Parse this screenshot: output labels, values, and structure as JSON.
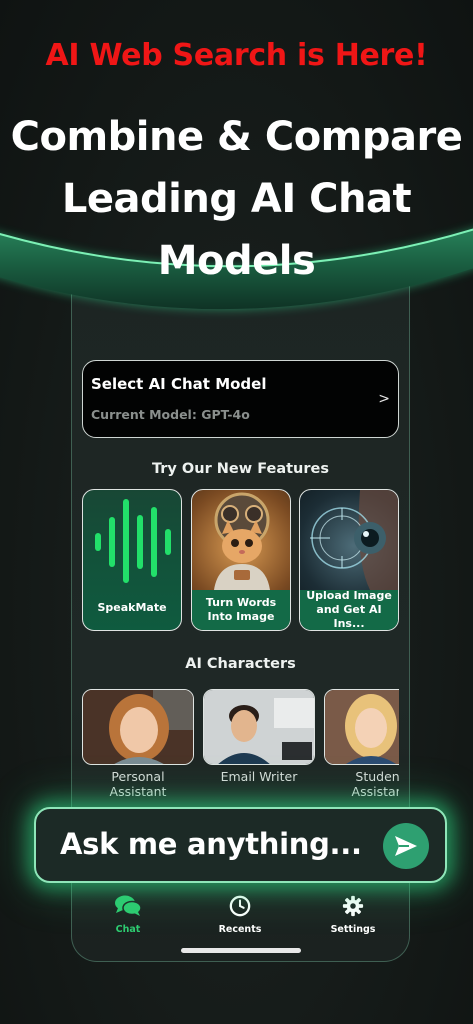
{
  "promo": {
    "text": "AI Web Search is Here!",
    "color": "#f01616"
  },
  "headline": {
    "line1": "Combine & Compare",
    "line2": "Leading AI Chat",
    "line3": "Models"
  },
  "model_selector": {
    "title": "Select AI Chat Model",
    "current": "Current Model: GPT-4o",
    "chevron": ">"
  },
  "features": {
    "title": "Try Our New Features",
    "items": [
      {
        "label": "SpeakMate",
        "icon": "waveform-icon"
      },
      {
        "label": "Turn Words\nInto Image",
        "icon": "astronaut-cat-image"
      },
      {
        "label": "Upload Image\nand Get AI Ins...",
        "icon": "cyber-eye-image"
      }
    ]
  },
  "characters": {
    "title": "AI Characters",
    "items": [
      {
        "label": "Personal\nAssistant",
        "icon": "woman-portrait"
      },
      {
        "label": "Email Writer",
        "icon": "man-portrait"
      },
      {
        "label": "Student\nAssistant",
        "icon": "girl-portrait"
      }
    ]
  },
  "ask": {
    "placeholder": "Ask me anything...",
    "icon": "send-icon"
  },
  "tabs": [
    {
      "label": "Chat",
      "icon": "chat-bubbles-icon",
      "active": true
    },
    {
      "label": "Recents",
      "icon": "clock-icon",
      "active": false
    },
    {
      "label": "Settings",
      "icon": "gear-icon",
      "active": false
    }
  ],
  "colors": {
    "accent": "#2ecc71",
    "band": "#1f6b4a",
    "send": "#2ea071"
  }
}
